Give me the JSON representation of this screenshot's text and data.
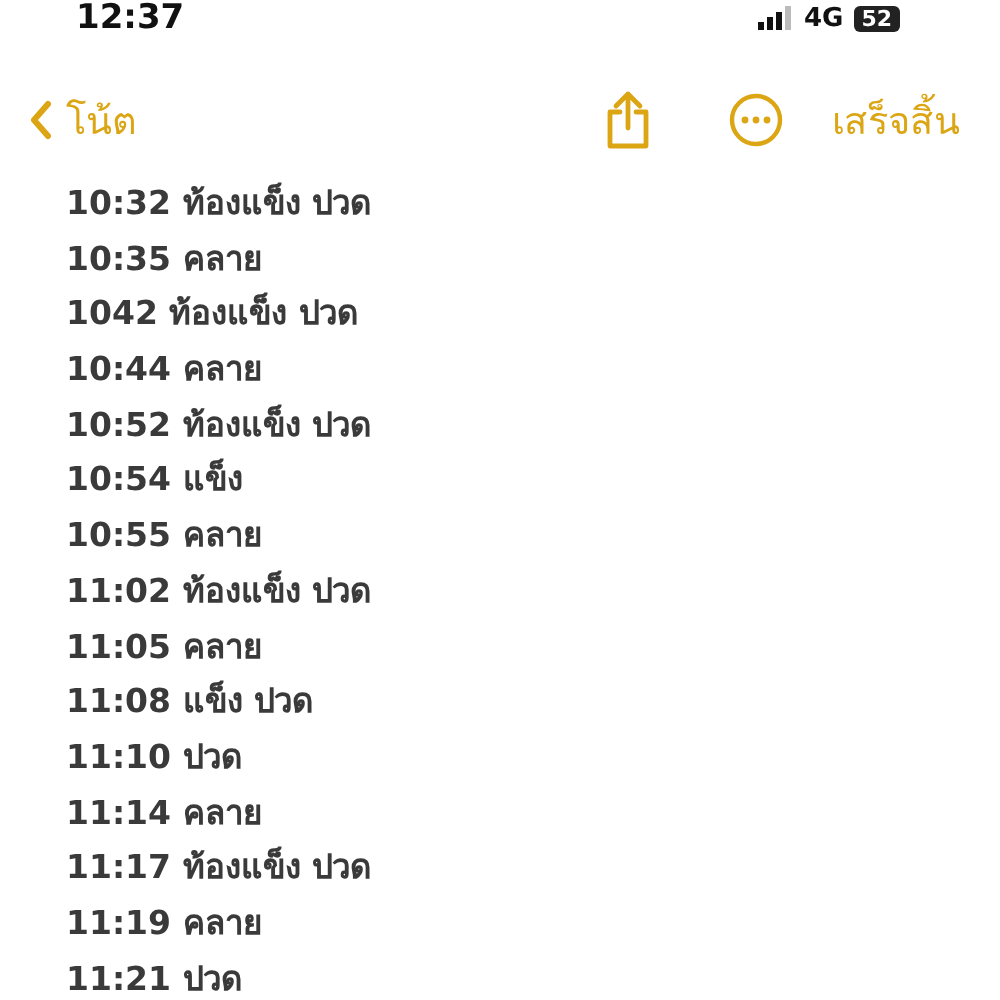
{
  "status_bar": {
    "time": "12:37",
    "network": "4G",
    "battery": "52"
  },
  "nav": {
    "back_label": "โน้ต",
    "done_label": "เสร็จสิ้น"
  },
  "lines": [
    "10:32 ท้องแข็ง ปวด",
    "10:35 คลาย",
    "1042 ท้องแข็ง ปวด",
    "10:44 คลาย",
    "10:52 ท้องแข็ง ปวด",
    "10:54 แข็ง",
    "10:55 คลาย",
    "11:02 ท้องแข็ง ปวด",
    "11:05 คลาย",
    "11:08 แข็ง ปวด",
    "11:10 ปวด",
    "11:14 คลาย",
    "11:17 ท้องแข็ง ปวด",
    "11:19 คลาย",
    "11:21 ปวด"
  ]
}
